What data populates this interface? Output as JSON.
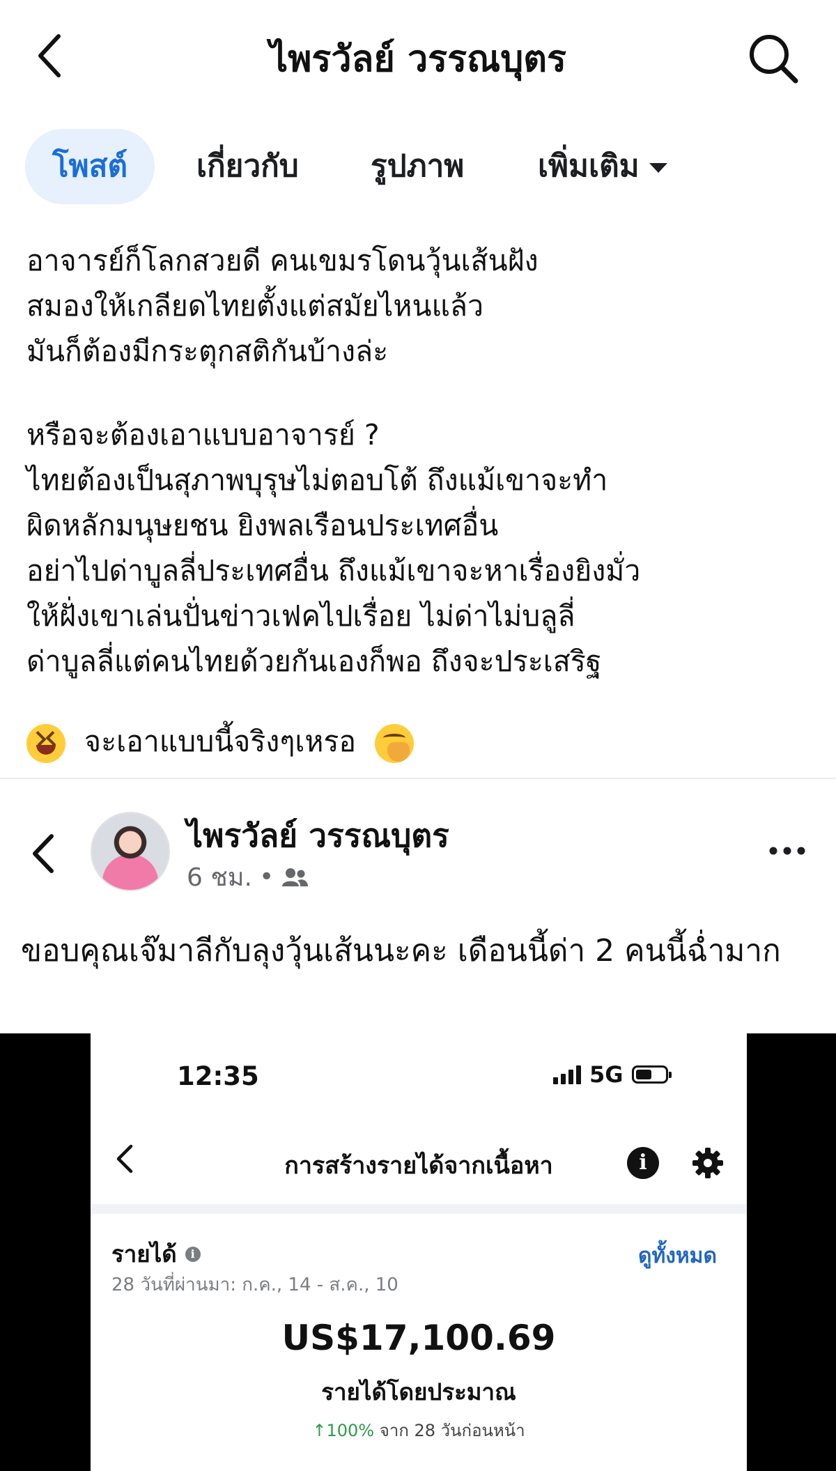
{
  "header": {
    "title": "ไพรวัลย์ วรรณบุตร",
    "back_icon": "chevron-left-icon",
    "search_icon": "search-icon"
  },
  "tabs": [
    {
      "label": "โพสต์",
      "active": true
    },
    {
      "label": "เกี่ยวกับ",
      "active": false
    },
    {
      "label": "รูปภาพ",
      "active": false
    },
    {
      "label": "เพิ่มเติม",
      "active": false,
      "icon": "caret-down-icon"
    }
  ],
  "post1": {
    "paragraph1": [
      "อาจารย์ก็โลกสวยดี คนเขมรโดนวุ้นเส้นฝัง",
      "สมองให้เกลียดไทยตั้งแต่สมัยไหนแล้ว",
      "มันก็ต้องมีกระตุกสติกันบ้างล่ะ"
    ],
    "paragraph2": [
      "หรือจะต้องเอาแบบอาจารย์ ?",
      "ไทยต้องเป็นสุภาพบุรุษไม่ตอบโต้ ถึงแม้เขาจะทำ",
      "ผิดหลักมนุษยชน ยิงพลเรือนประเทศอื่น",
      "อย่าไปด่าบูลลี่ประเทศอื่น ถึงแม้เขาจะหาเรื่องยิงมั่ว",
      "ให้ฝั่งเขาเล่นปั่นข่าวเฟคไปเรื่อย ไม่ด่าไม่บลูลี่",
      "ด่าบูลลี่แต่คนไทยด้วยกันเองก็พอ ถึงจะประเสริฐ"
    ],
    "closing": "จะเอาแบบนี้จริงๆเหรอ",
    "closing_emoji_left": "laughing-emoji-icon",
    "closing_emoji_right": "hand-over-mouth-emoji-icon"
  },
  "post2": {
    "author": "ไพรวัลย์ วรรณบุตร",
    "time": "6 ชม.",
    "dot": "•",
    "audience_icon": "friends-icon",
    "more_icon": "more-dots-icon",
    "text": "ขอบคุณเจ๊มาลีกับลุงวุ้นเส้นนะคะ เดือนนี้ด่า 2 คนนี้ฉ่ำมาก"
  },
  "embedded_screenshot": {
    "status_time": "12:35",
    "network": "5G",
    "title": "การสร้างรายได้จากเนื้อหา",
    "info_label": "i",
    "earnings_label": "รายได้",
    "earnings_range": "28 วันที่ผ่านมา: ก.ค., 14 - ส.ค., 10",
    "see_all": "ดูทั้งหมด",
    "amount": "US$17,100.69",
    "amount_label": "รายได้โดยประมาณ",
    "change_pct": "↑100%",
    "change_text": "จาก 28 วันก่อนหน้า"
  }
}
